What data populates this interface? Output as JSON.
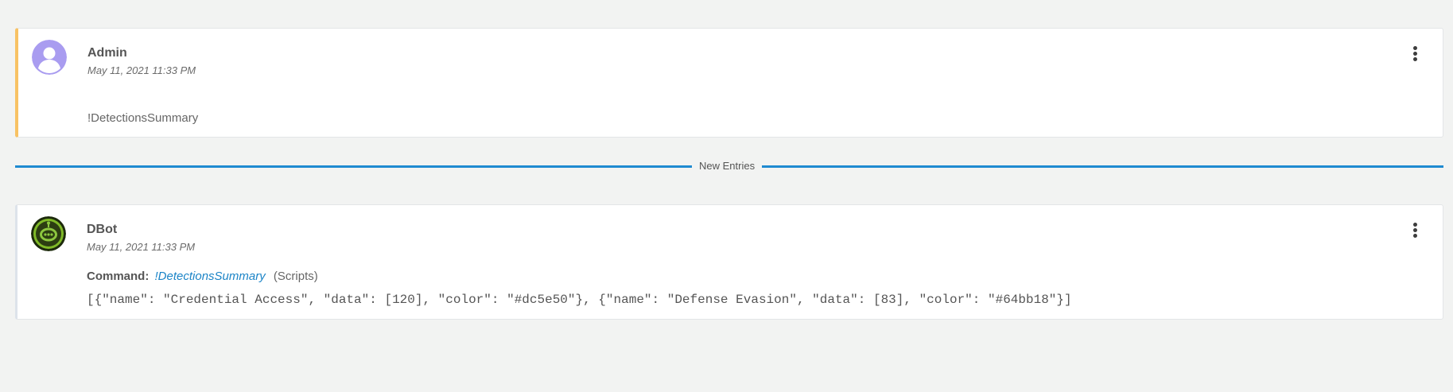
{
  "entries": [
    {
      "author": "Admin",
      "timestamp": "May 11, 2021 11:33 PM",
      "text": "!DetectionsSummary",
      "avatar_icon": "user-icon",
      "accent_color": "#f8c264"
    },
    {
      "author": "DBot",
      "timestamp": "May 11, 2021 11:33 PM",
      "avatar_icon": "robot-icon",
      "command_label": "Command:",
      "command_name": "!DetectionsSummary",
      "command_source": "(Scripts)",
      "output": "[{\"name\": \"Credential Access\", \"data\": [120], \"color\": \"#dc5e50\"}, {\"name\": \"Defense Evasion\", \"data\": [83], \"color\": \"#64bb18\"}]"
    }
  ],
  "divider": {
    "label": "New Entries",
    "color": "#1f8ad1"
  },
  "menu_icon": "kebab-menu-icon"
}
